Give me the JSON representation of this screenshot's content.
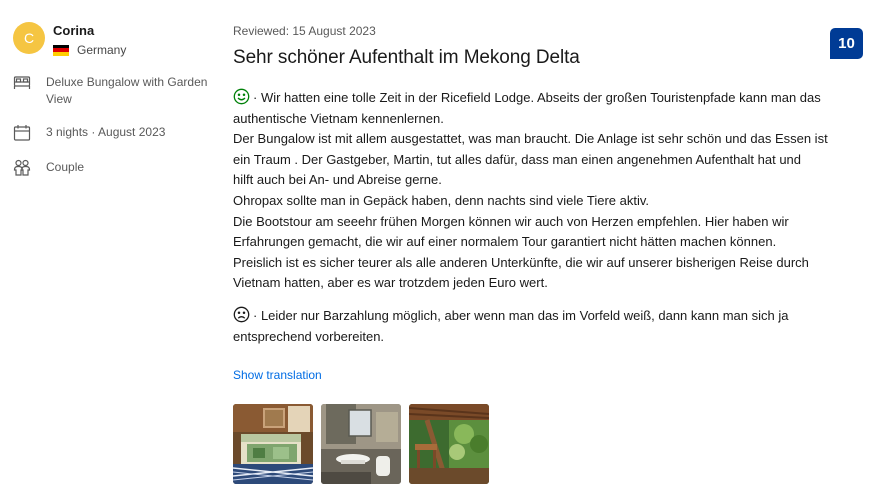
{
  "reviewer": {
    "initial": "C",
    "name": "Corina",
    "country": "Germany"
  },
  "stay": {
    "room": "Deluxe Bungalow with Garden View",
    "room_line1": "Deluxe Bungalow with Garden",
    "room_line2": "View",
    "duration": "3 nights · August 2023",
    "traveler_type": "Couple"
  },
  "review": {
    "reviewed_date": "Reviewed: 15 August 2023",
    "title": "Sehr schöner Aufenthalt im Mekong Delta",
    "score": "10",
    "positive_lines": [
      "· Wir hatten eine tolle Zeit in der Ricefield Lodge. Abseits der großen Touristenpfade kann man das",
      "authentische Vietnam kennenlernen.",
      "Der Bungalow ist mit allem ausgestattet, was man braucht. Die Anlage ist sehr schön und das Essen ist",
      "ein Traum . Der Gastgeber, Martin, tut alles dafür, dass man einen angenehmen Aufenthalt hat und",
      "hilft auch bei An- und Abreise gerne.",
      "Ohropax sollte man in Gepäck haben, denn nachts sind viele Tiere aktiv.",
      "Die Bootstour am seeehr frühen Morgen können wir auch von Herzen empfehlen. Hier haben wir",
      "Erfahrungen gemacht, die wir auf einer normalem Tour garantiert nicht hätten machen können.",
      "Preislich ist es sicher teurer als alle anderen Unterkünfte, die wir auf unserer bisherigen Reise durch",
      "Vietnam hatten, aber es war trotzdem jeden Euro wert."
    ],
    "negative_lines": [
      "· Leider nur Barzahlung möglich, aber wenn man das im Vorfeld weiß, dann kann man sich ja",
      "entsprechend vorbereiten."
    ],
    "show_translation": "Show translation"
  },
  "icons": {
    "room": "bed-icon",
    "duration": "calendar-icon",
    "group": "people-icon",
    "liked": "smiley-happy-icon",
    "disliked": "smiley-sad-icon"
  },
  "colors": {
    "score_badge": "#003b95",
    "link": "#006ce4",
    "positive": "#008009",
    "avatar": "#f5c542"
  }
}
